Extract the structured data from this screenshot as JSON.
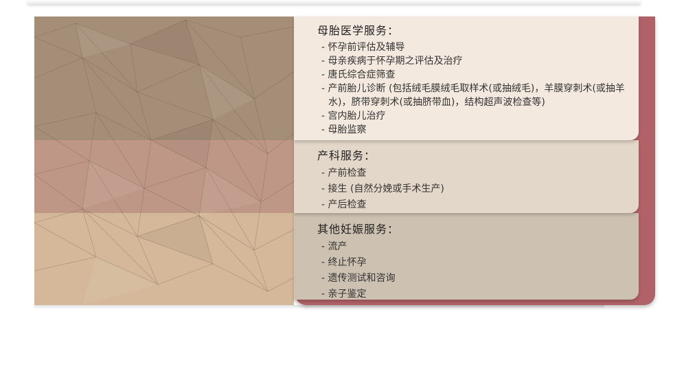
{
  "sections": [
    {
      "title": "母胎医学服务：",
      "items": [
        "怀孕前评估及辅导",
        "母亲疾病于怀孕期之评估及治疗",
        "唐氏综合症筛查",
        "产前胎儿诊断 (包括绒毛膜绒毛取样术(或抽绒毛)，羊膜穿刺术(或抽羊水)，脐带穿刺术(或抽脐带血)，结构超声波检查等)",
        "宫内胎儿治疗",
        "母胎监察"
      ]
    },
    {
      "title": "产科服务：",
      "items": [
        "产前检查",
        "接生 (自然分娩或手术生产)",
        "产后检查"
      ]
    },
    {
      "title": "其他妊娠服务：",
      "items": [
        "流产",
        "终止怀孕",
        "遗传测试和咨询",
        "亲子鉴定"
      ]
    }
  ],
  "colors": {
    "accent": "#b06268",
    "panel_1": "#f3e9de",
    "panel_2": "#e3d7c9",
    "panel_3": "#cdc1b1"
  }
}
